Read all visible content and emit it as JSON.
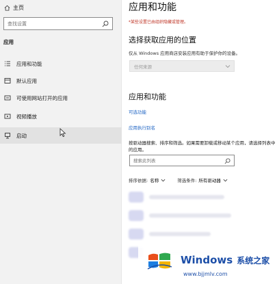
{
  "sidebar": {
    "home_label": "主页",
    "search_placeholder": "查找设置",
    "section_label": "应用",
    "items": [
      {
        "label": "应用和功能",
        "icon": "apps-list-icon"
      },
      {
        "label": "默认应用",
        "icon": "default-apps-icon"
      },
      {
        "label": "可使用网站打开的应用",
        "icon": "open-with-website-icon"
      },
      {
        "label": "视频播放",
        "icon": "video-playback-icon"
      },
      {
        "label": "启动",
        "icon": "startup-icon"
      }
    ]
  },
  "main": {
    "title": "应用和功能",
    "warning": "*某些设置已由组织隐藏或管理。",
    "choose_title": "选择获取应用的位置",
    "choose_desc": "仅从 Windows 应用商店安装应用有助于保护你的设备。",
    "dropdown_value": "任何来源",
    "section2_title": "应用和功能",
    "link_optional": "可选功能",
    "link_alias": "应用执行别名",
    "body_text": "按驱动器搜索、排序和筛选。如果需要卸载或移动某个应用，请选择列表中的应用。",
    "list_search_placeholder": "搜索此列表",
    "sort_label": "排序依据:",
    "sort_value": "名称",
    "filter_label": "筛选条件:",
    "filter_value": "所有驱动器"
  },
  "watermark": {
    "brand": "Windows",
    "cn": "系统之家",
    "url": "www.bjjmlv.com"
  },
  "colors": {
    "accent": "#2166c4",
    "warning": "#c0392b",
    "watermark": "#1d4fa8"
  }
}
